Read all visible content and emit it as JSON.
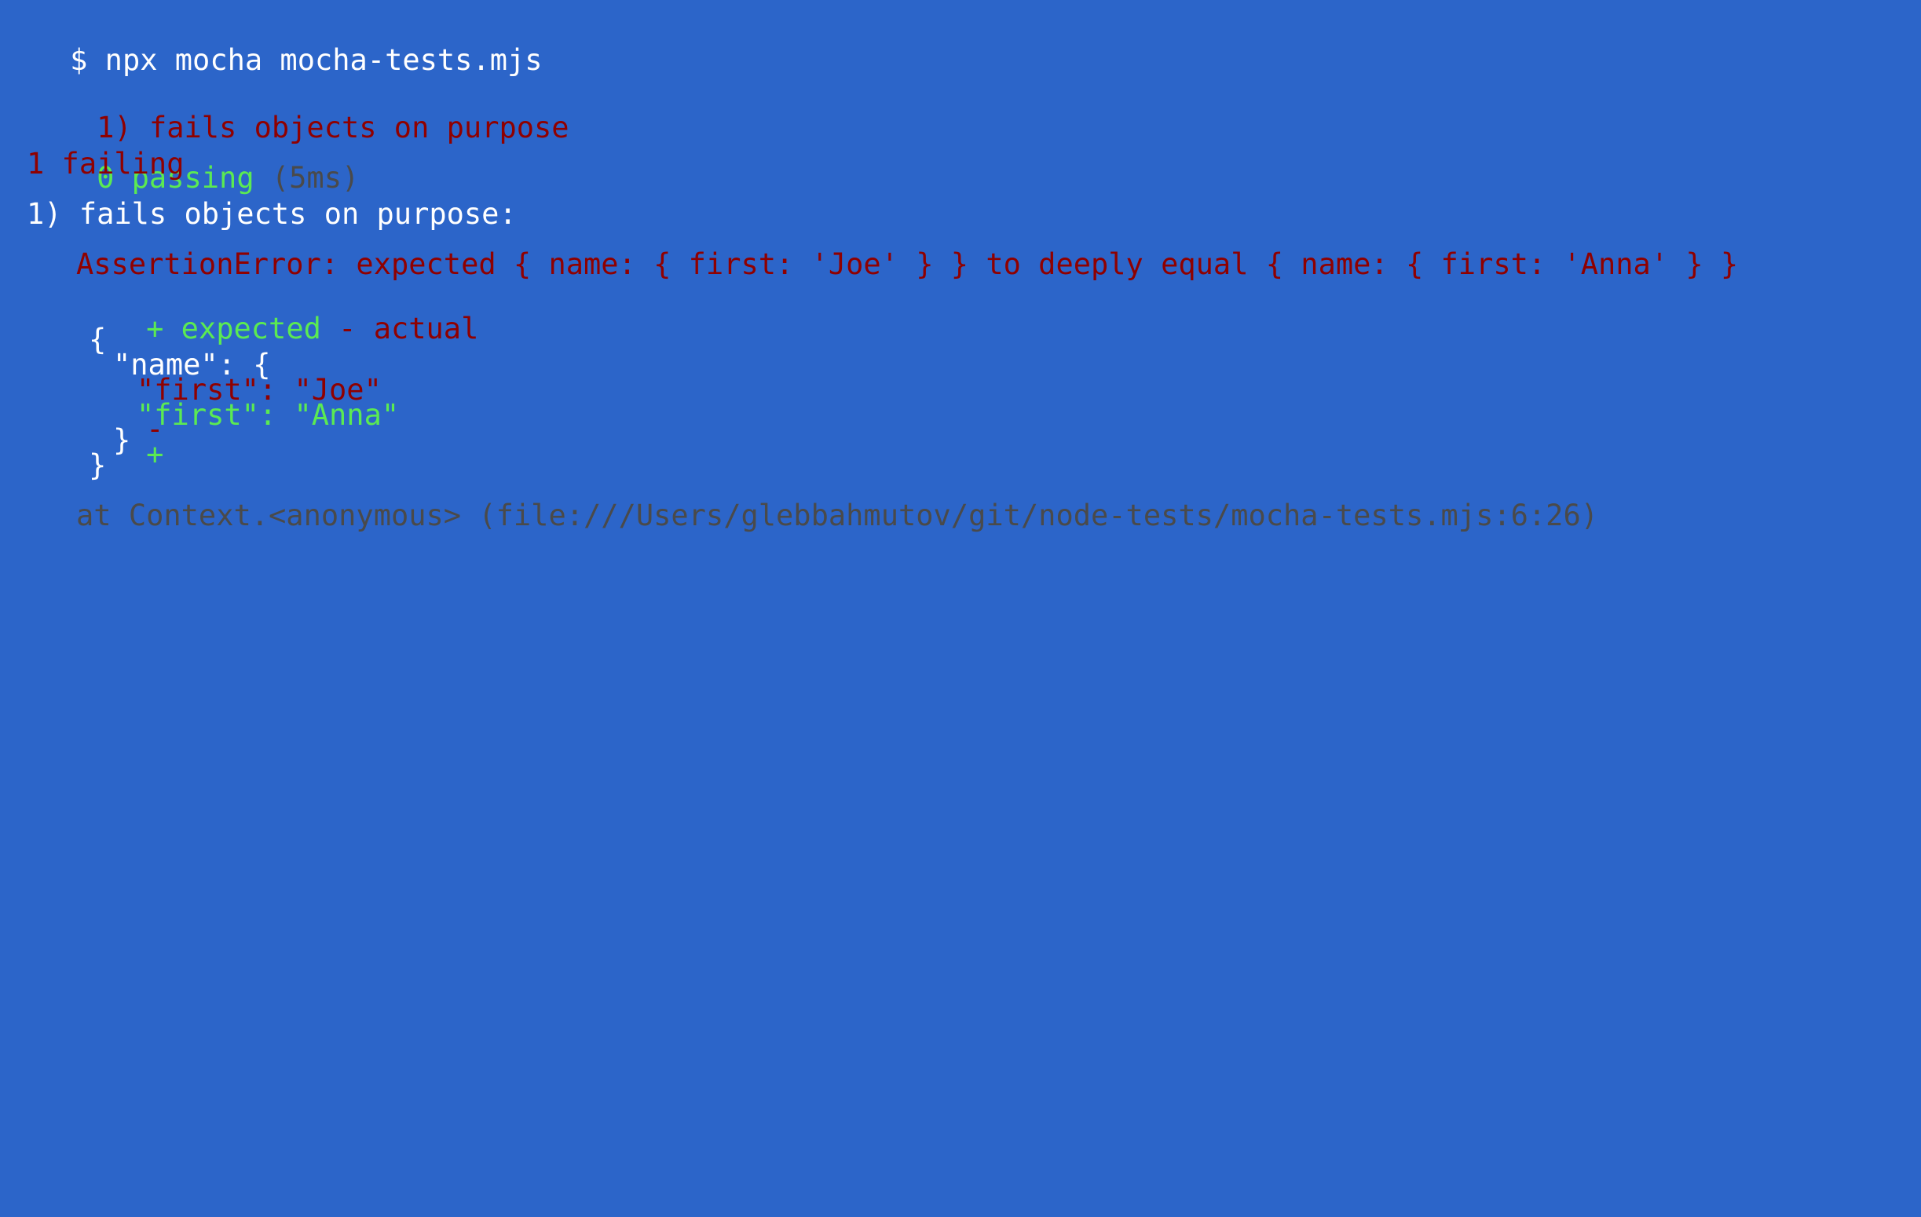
{
  "colors": {
    "background": "#2c65c9",
    "text": "#ffffff",
    "error": "#8f0000",
    "success": "#5bea52",
    "muted": "#4a4a4a"
  },
  "command": {
    "prompt": "$",
    "text": " npx mocha mocha-tests.mjs"
  },
  "summary": {
    "failure_index": "1)",
    "failure_title": " fails objects on purpose",
    "passing_count": "0 passing",
    "passing_time": " (5ms)",
    "failing_count": "1 failing"
  },
  "failure": {
    "heading": "1) fails objects on purpose:",
    "assertion": "AssertionError: expected { name: { first: 'Joe' } } to deeply equal { name: { first: 'Anna' } }",
    "legend_expected": "+ expected",
    "legend_actual": " - actual",
    "diff": {
      "open_brace": "{",
      "name_line": "\"name\": {",
      "minus_sign": "-",
      "minus_value": "\"first\": \"Joe\"",
      "plus_sign": "+",
      "plus_value": "\"first\": \"Anna\"",
      "inner_close": "}",
      "outer_close": "}"
    },
    "stack": "at Context.<anonymous> (file:///Users/glebbahmutov/git/node-tests/mocha-tests.mjs:6:26)"
  }
}
